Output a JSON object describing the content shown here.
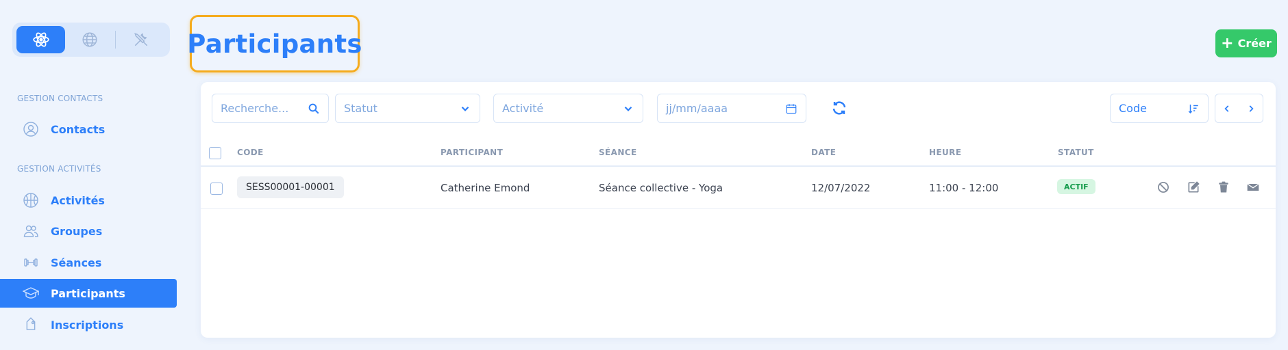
{
  "page_title": "Participants",
  "create_button": "Créer",
  "mode_switch": {
    "items": [
      {
        "icon": "atom-icon",
        "active": true
      },
      {
        "icon": "globe-icon",
        "active": false
      },
      {
        "icon": "tools-icon",
        "active": false
      }
    ]
  },
  "sidebar": {
    "sections": [
      {
        "label": "GESTION CONTACTS"
      },
      {
        "label": "GESTION ACTIVITÉS"
      }
    ],
    "items": [
      {
        "label": "Contacts",
        "icon": "user-circle-icon",
        "active": false
      },
      {
        "label": "Activités",
        "icon": "basketball-icon",
        "active": false
      },
      {
        "label": "Groupes",
        "icon": "users-icon",
        "active": false
      },
      {
        "label": "Séances",
        "icon": "dumbbell-icon",
        "active": false
      },
      {
        "label": "Participants",
        "icon": "graduation-cap-icon",
        "active": true
      },
      {
        "label": "Inscriptions",
        "icon": "tag-icon",
        "active": false
      }
    ]
  },
  "filters": {
    "search_placeholder": "Recherche...",
    "status_placeholder": "Statut",
    "activity_placeholder": "Activité",
    "date_placeholder": "jj/mm/aaaa",
    "sort_label": "Code"
  },
  "table": {
    "columns": [
      "CODE",
      "PARTICIPANT",
      "SÉANCE",
      "DATE",
      "HEURE",
      "STATUT"
    ],
    "rows": [
      {
        "code": "SESS00001-00001",
        "participant": "Catherine Emond",
        "seance": "Séance collective - Yoga",
        "date": "12/07/2022",
        "heure": "11:00 - 12:00",
        "statut": "ACTIF"
      }
    ]
  },
  "colors": {
    "primary": "#2d7ff9",
    "success": "#35c96a",
    "highlight": "#f5ab1d",
    "badge_bg": "#d6f6e2",
    "badge_text": "#189d4e"
  }
}
